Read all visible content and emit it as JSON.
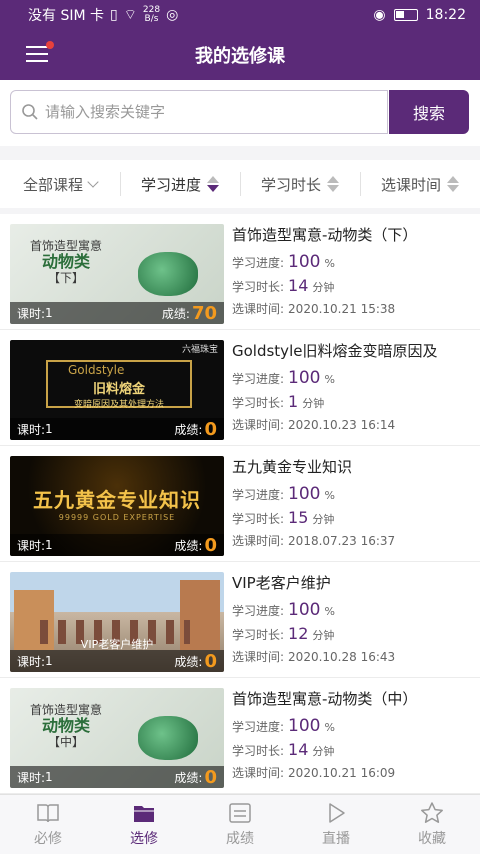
{
  "status": {
    "carrier": "没有 SIM 卡",
    "speed_value": "228",
    "speed_unit": "B/s",
    "time": "18:22"
  },
  "header": {
    "title": "我的选修课"
  },
  "search": {
    "placeholder": "请输入搜索关键字",
    "button_label": "搜索"
  },
  "filters": {
    "all_courses": "全部课程",
    "progress": "学习进度",
    "duration": "学习时长",
    "select_time": "选课时间"
  },
  "labels": {
    "lessons": "课时:",
    "score": "成绩:",
    "progress": "学习进度:",
    "duration": "学习时长:",
    "select_time": "选课时间:",
    "minute_unit": "分钟"
  },
  "courses": [
    {
      "title": "首饰造型寓意-动物类（下）",
      "lessons": "1",
      "score": "70",
      "progress_value": "100",
      "progress_unit": "%",
      "duration": "14",
      "select_time": "2020.10.21 15:38",
      "thumb_line1": "首饰造型寓意",
      "thumb_line2": "动物类",
      "thumb_line3": "【下】"
    },
    {
      "title": "Goldstyle旧料熔金变暗原因及",
      "lessons": "1",
      "score": "0",
      "progress_value": "100",
      "progress_unit": "%",
      "duration": "1",
      "select_time": "2020.10.23 16:14",
      "thumb_brand": "六福珠宝",
      "thumb_line1": "Goldstyle",
      "thumb_line2": "旧料熔金",
      "thumb_line3": "变暗原因及其处理方法"
    },
    {
      "title": "五九黄金专业知识",
      "lessons": "1",
      "score": "0",
      "progress_value": "100",
      "progress_unit": "%",
      "duration": "15",
      "select_time": "2018.07.23 16:37",
      "thumb_line1": "五九黄金专业知识",
      "thumb_line2": "99999 GOLD EXPERTISE"
    },
    {
      "title": "VIP老客户维护",
      "lessons": "1",
      "score": "0",
      "progress_value": "100",
      "progress_unit": "%",
      "duration": "12",
      "select_time": "2020.10.28 16:43",
      "thumb_line1": "VIP老客户维护"
    },
    {
      "title": "首饰造型寓意-动物类（中）",
      "lessons": "1",
      "score": "0",
      "progress_value": "100",
      "progress_unit": "%",
      "duration": "14",
      "select_time": "2020.10.21 16:09",
      "thumb_line1": "首饰造型寓意",
      "thumb_line2": "动物类",
      "thumb_line3": "【中】"
    }
  ],
  "nav": [
    {
      "label": "必修",
      "icon": "book-icon"
    },
    {
      "label": "选修",
      "icon": "folder-icon"
    },
    {
      "label": "成绩",
      "icon": "report-icon"
    },
    {
      "label": "直播",
      "icon": "play-icon"
    },
    {
      "label": "收藏",
      "icon": "star-icon"
    }
  ],
  "colors": {
    "primary": "#5b2a78",
    "score": "#f39a1e"
  }
}
